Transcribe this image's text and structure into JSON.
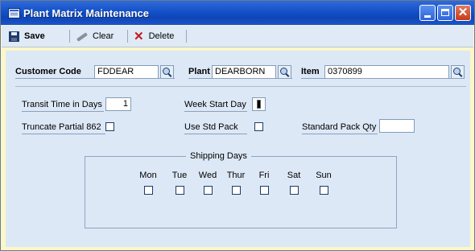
{
  "window": {
    "title": "Plant Matrix Maintenance",
    "icon": "window-form-icon",
    "background": "#fbf7c9",
    "titlebar_color": "#1451c9"
  },
  "toolbar": {
    "save_label": "Save",
    "clear_label": "Clear",
    "delete_label": "Delete"
  },
  "form": {
    "customer_code": {
      "label": "Customer Code",
      "value": "FDDEAR"
    },
    "plant": {
      "label": "Plant",
      "value": "DEARBORN"
    },
    "item": {
      "label": "Item",
      "value": "0370899"
    },
    "transit_time": {
      "label": "Transit Time in Days",
      "value": "1"
    },
    "week_start_day": {
      "label": "Week Start Day"
    },
    "truncate_partial": {
      "label": "Truncate Partial 862",
      "checked": false
    },
    "use_std_pack": {
      "label": "Use Std Pack",
      "checked": false
    },
    "standard_pack_qty": {
      "label": "Standard Pack Qty",
      "value": ""
    }
  },
  "shipping_days": {
    "title": "Shipping Days",
    "days": [
      {
        "label": "Mon",
        "checked": false
      },
      {
        "label": "Tue",
        "checked": false
      },
      {
        "label": "Wed",
        "checked": false
      },
      {
        "label": "Thur",
        "checked": false
      },
      {
        "label": "Fri",
        "checked": false
      },
      {
        "label": "Sat",
        "checked": false
      },
      {
        "label": "Sun",
        "checked": false
      }
    ]
  }
}
